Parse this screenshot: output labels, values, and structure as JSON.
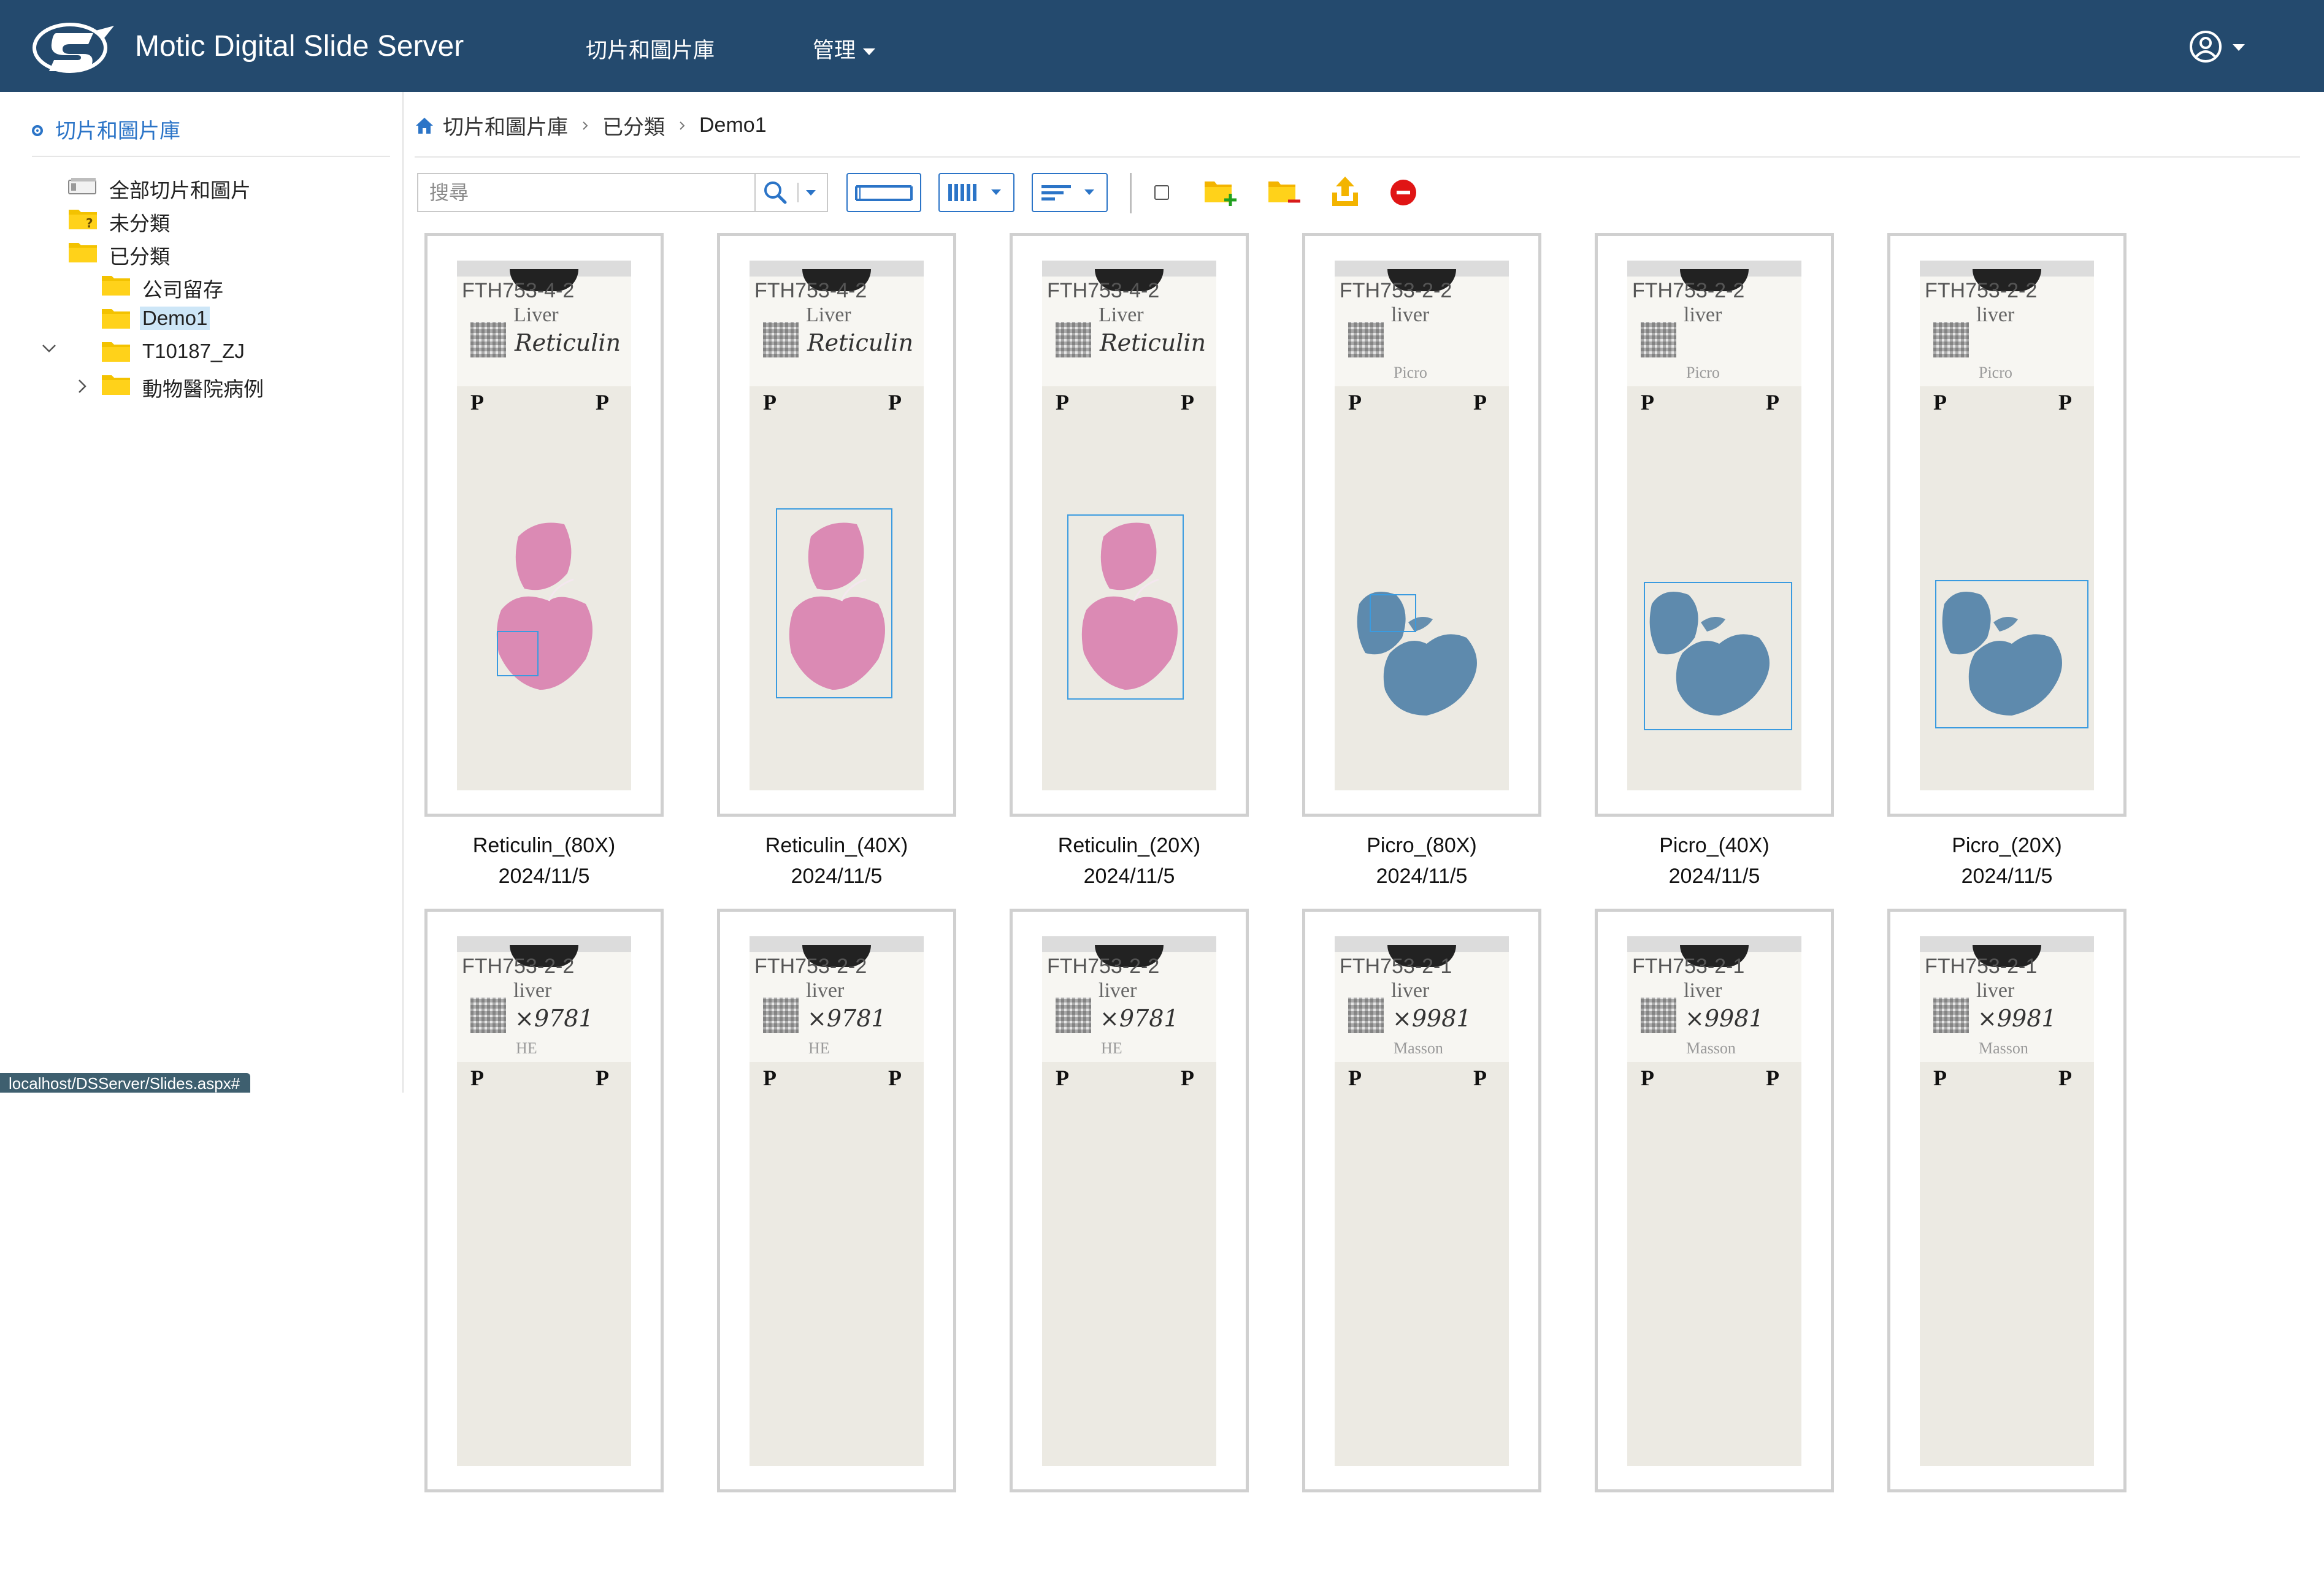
{
  "app": {
    "title": "Motic Digital Slide Server",
    "brand_color": "#244a6e",
    "accent_color": "#2b74c7"
  },
  "nav": {
    "library": "切片和圖片庫",
    "admin": "管理",
    "user_icon": "user-circle-icon"
  },
  "sidebar": {
    "header": "切片和圖片庫",
    "tree": [
      {
        "label": "全部切片和圖片",
        "icon": "all-slides-icon"
      },
      {
        "label": "未分類",
        "icon": "folder-question-icon"
      },
      {
        "label": "已分類",
        "icon": "folder-icon",
        "expanded": true
      },
      {
        "label": "公司留存",
        "icon": "folder-icon"
      },
      {
        "label": "Demo1",
        "icon": "folder-icon",
        "selected": true
      },
      {
        "label": "T10187_ZJ",
        "icon": "folder-icon"
      },
      {
        "label": "動物醫院病例",
        "icon": "folder-icon",
        "expanded": false
      }
    ]
  },
  "breadcrumb": {
    "home": "切片和圖片庫",
    "level1": "已分類",
    "current": "Demo1"
  },
  "toolbar": {
    "search_placeholder": "搜尋"
  },
  "status_bar": {
    "url": "localhost/DSServer/Slides.aspx#"
  },
  "slides": [
    {
      "name": "Reticulin_(80X)",
      "date": "2024/11/5",
      "code": "FTH753-4-2",
      "organ": "Liver",
      "note": "Reticulin",
      "stain": "",
      "tissue_color": "#d97fae"
    },
    {
      "name": "Reticulin_(40X)",
      "date": "2024/11/5",
      "code": "FTH753-4-2",
      "organ": "Liver",
      "note": "Reticulin",
      "stain": "",
      "tissue_color": "#d97fae"
    },
    {
      "name": "Reticulin_(20X)",
      "date": "2024/11/5",
      "code": "FTH753-4-2",
      "organ": "Liver",
      "note": "Reticulin",
      "stain": "",
      "tissue_color": "#d97fae"
    },
    {
      "name": "Picro_(80X)",
      "date": "2024/11/5",
      "code": "FTH753-2-2",
      "organ": "liver",
      "note": "",
      "stain": "Picro",
      "tissue_color": "#4f7fa6"
    },
    {
      "name": "Picro_(40X)",
      "date": "2024/11/5",
      "code": "FTH753-2-2",
      "organ": "liver",
      "note": "",
      "stain": "Picro",
      "tissue_color": "#4f7fa6"
    },
    {
      "name": "Picro_(20X)",
      "date": "2024/11/5",
      "code": "FTH753-2-2",
      "organ": "liver",
      "note": "",
      "stain": "Picro",
      "tissue_color": "#4f7fa6"
    },
    {
      "name": "",
      "date": "",
      "code": "FTH753-2-2",
      "organ": "liver",
      "note": "×9781",
      "stain": "HE",
      "tissue_color": ""
    },
    {
      "name": "",
      "date": "",
      "code": "FTH753-2-2",
      "organ": "liver",
      "note": "×9781",
      "stain": "HE",
      "tissue_color": ""
    },
    {
      "name": "",
      "date": "",
      "code": "FTH753-2-2",
      "organ": "liver",
      "note": "×9781",
      "stain": "HE",
      "tissue_color": ""
    },
    {
      "name": "",
      "date": "",
      "code": "FTH753-2-1",
      "organ": "liver",
      "note": "×9981",
      "stain": "Masson",
      "tissue_color": ""
    },
    {
      "name": "",
      "date": "",
      "code": "FTH753-2-1",
      "organ": "liver",
      "note": "×9981",
      "stain": "Masson",
      "tissue_color": ""
    },
    {
      "name": "",
      "date": "",
      "code": "FTH753-2-1",
      "organ": "liver",
      "note": "×9981",
      "stain": "Masson",
      "tissue_color": ""
    }
  ]
}
